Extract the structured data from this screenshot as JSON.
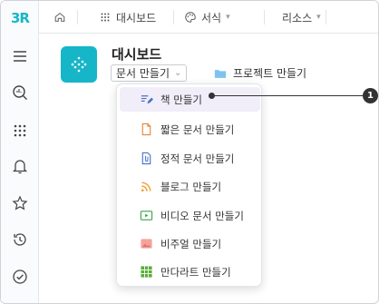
{
  "brand": {
    "logo_text": "3R",
    "accent": "#16b6c8"
  },
  "sidebar": {
    "icons": [
      "menu-icon",
      "search-icon",
      "apps-grid-icon",
      "bell-icon",
      "star-icon",
      "history-icon",
      "check-circle-icon"
    ]
  },
  "topbar": {
    "home_icon": "home-icon",
    "tabs": [
      {
        "label": "대시보드",
        "icon": "dashboard-icon"
      },
      {
        "label": "서식",
        "icon": "palette-icon"
      },
      {
        "label": "리소스",
        "icon": ""
      }
    ]
  },
  "header": {
    "title": "대시보드",
    "doc_dropdown_label": "문서 만들기",
    "project_label": "프로젝트 만들기"
  },
  "menu": {
    "items": [
      {
        "label": "책 만들기",
        "icon": "edit-book-icon",
        "color": "#4a73c9",
        "active": true
      },
      {
        "label": "짧은 문서 만들기",
        "icon": "document-icon",
        "color": "#e8863a"
      },
      {
        "label": "정적 문서 만들기",
        "icon": "attachment-doc-icon",
        "color": "#4a73c9"
      },
      {
        "label": "블로그 만들기",
        "icon": "rss-icon",
        "color": "#f0a030"
      },
      {
        "label": "비디오 문서 만들기",
        "icon": "video-doc-icon",
        "color": "#3aa34a"
      },
      {
        "label": "비주얼 만들기",
        "icon": "image-icon",
        "color": "#e8706a"
      },
      {
        "label": "만다라트 만들기",
        "icon": "grid-icon",
        "color": "#5aae3c"
      }
    ]
  },
  "callout": {
    "number": "1"
  }
}
